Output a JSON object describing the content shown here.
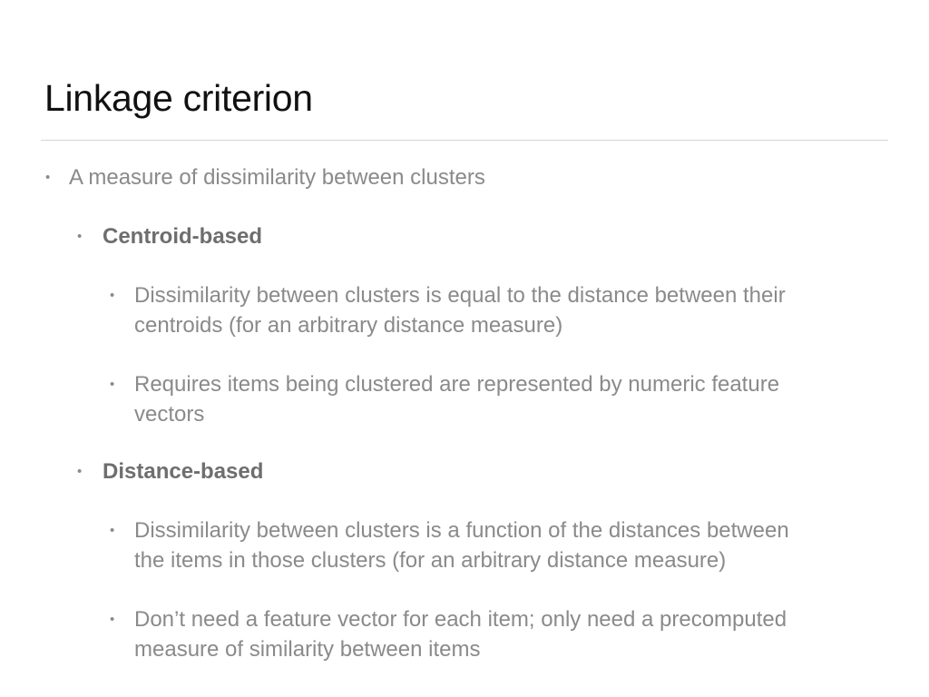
{
  "slide": {
    "title": "Linkage criterion",
    "bullet_glyph": "•",
    "bullets": [
      {
        "level": 1,
        "lines": [
          "A measure of dissimilarity between clusters"
        ]
      },
      {
        "level": 2,
        "bold": true,
        "lines": [
          "Centroid-based"
        ]
      },
      {
        "level": 3,
        "lines": [
          "Dissimilarity between clusters is equal to the distance between their",
          "centroids (for an arbitrary distance measure)"
        ]
      },
      {
        "level": 3,
        "lines": [
          "Requires items being clustered are represented by numeric feature",
          "vectors"
        ]
      },
      {
        "level": 2,
        "bold": true,
        "lines": [
          "Distance-based"
        ]
      },
      {
        "level": 3,
        "lines": [
          "Dissimilarity between clusters is a function of the distances between",
          "the items in those clusters (for an arbitrary distance measure)"
        ]
      },
      {
        "level": 3,
        "lines": [
          "Don’t need a feature vector for each item; only need a precomputed",
          "measure of similarity between items"
        ]
      }
    ]
  }
}
